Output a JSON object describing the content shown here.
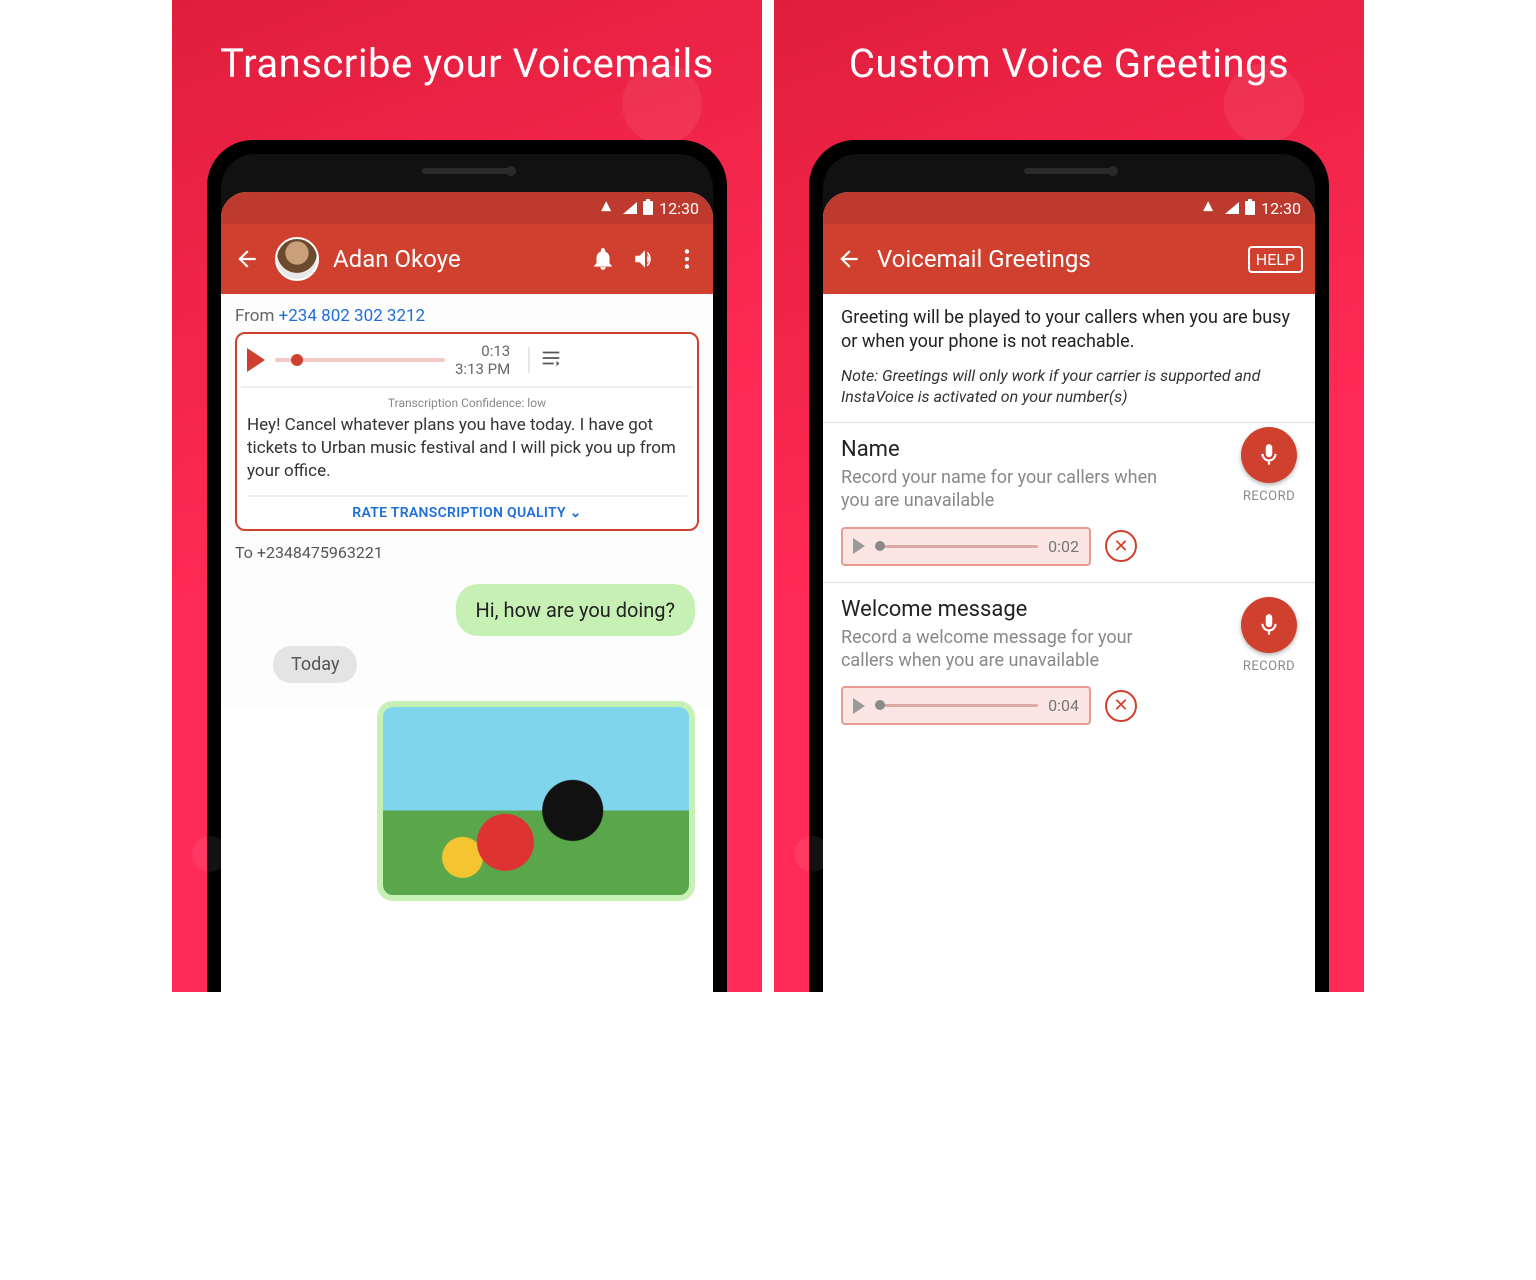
{
  "panels": {
    "left_title": "Transcribe your Voicemails",
    "right_title": "Custom Voice Greetings"
  },
  "status": {
    "time": "12:30"
  },
  "left": {
    "contact_name": "Adan Okoye",
    "from_label": "From ",
    "from_number": "+234 802 302 3212",
    "player": {
      "duration": "0:13",
      "timestamp": "3:13 PM"
    },
    "confidence": "Transcription Confidence: low",
    "transcript": "Hey! Cancel whatever plans you have today. I have got tickets to Urban music festival and I will pick you up from your office.",
    "rate_label": "RATE TRANSCRIPTION QUALITY",
    "to_line": "To +2348475963221",
    "outgoing_msg": "Hi, how are you doing?",
    "day_chip": "Today"
  },
  "right": {
    "title": "Voicemail Greetings",
    "help": "HELP",
    "info": "Greeting will be played to your callers when you are busy or when your phone is not reachable.",
    "note": "Note: Greetings will only work if your carrier is supported and InstaVoice is activated on your number(s)",
    "record_label": "RECORD",
    "sections": [
      {
        "title": "Name",
        "sub": "Record your name for your callers when you are unavailable",
        "dur": "0:02"
      },
      {
        "title": "Welcome message",
        "sub": "Record a welcome message for your callers when you are unavailable",
        "dur": "0:04"
      }
    ]
  }
}
